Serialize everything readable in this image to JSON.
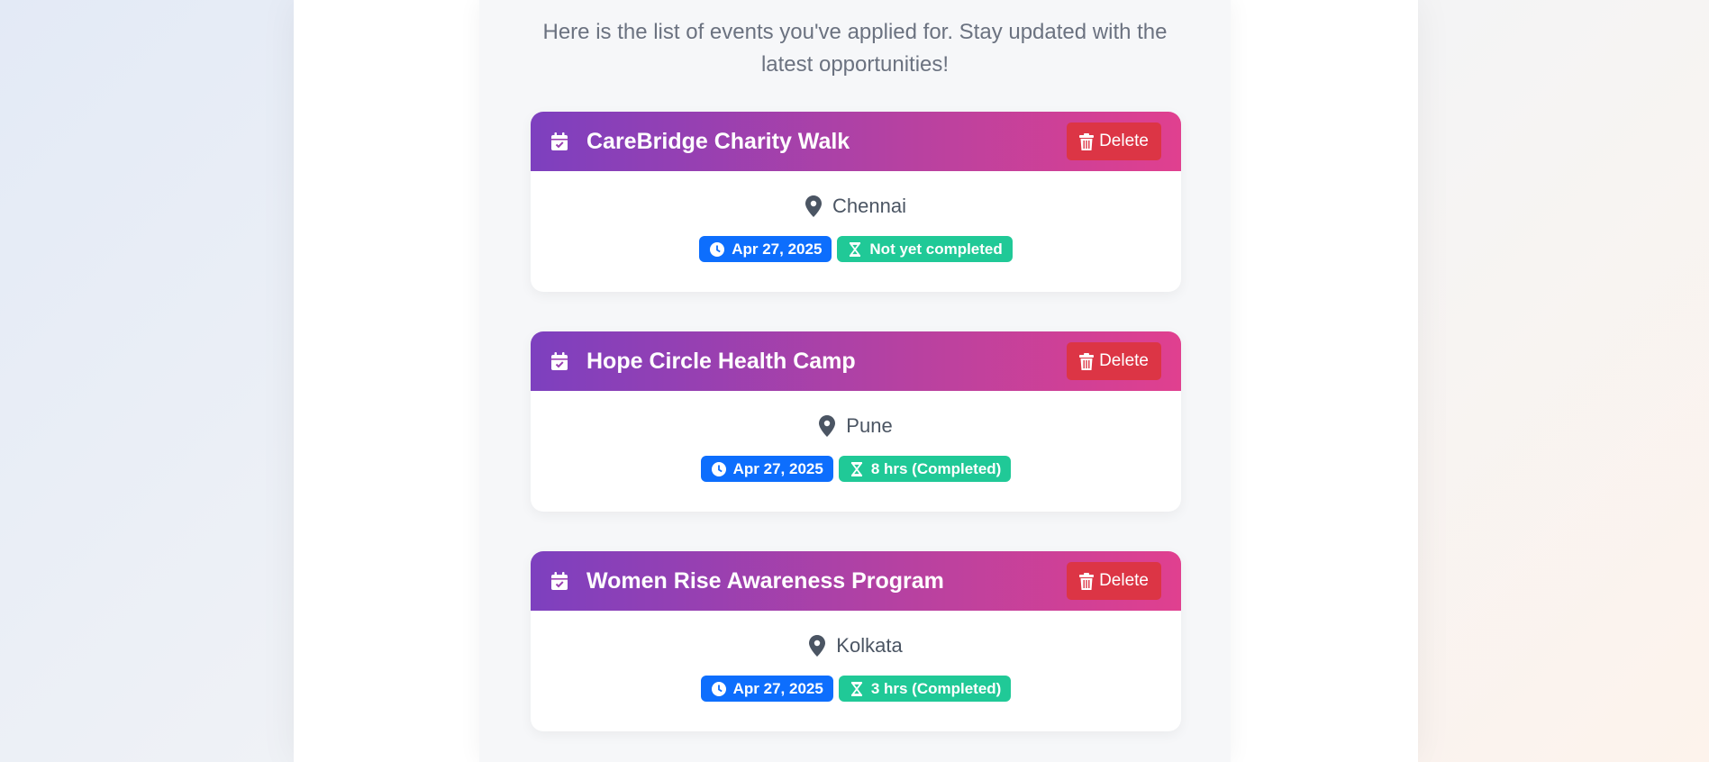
{
  "intro_text": "Here is the list of events you've applied for. Stay updated with the latest opportunities!",
  "delete_label": "Delete",
  "events": [
    {
      "title": "CareBridge Charity Walk",
      "location": "Chennai",
      "date": "Apr 27, 2025",
      "status": "Not yet completed"
    },
    {
      "title": "Hope Circle Health Camp",
      "location": "Pune",
      "date": "Apr 27, 2025",
      "status": "8 hrs (Completed)"
    },
    {
      "title": "Women Rise Awareness Program",
      "location": "Kolkata",
      "date": "Apr 27, 2025",
      "status": "3 hrs (Completed)"
    }
  ],
  "icons": {
    "header": "calendar-check-icon",
    "delete": "trash-icon",
    "location": "map-pin-icon",
    "date": "clock-icon",
    "status": "hourglass-icon"
  },
  "colors": {
    "header_gradient_start": "#7d40bf",
    "header_gradient_end": "#e0408f",
    "delete_button": "#dc3545",
    "date_badge": "#0d6efd",
    "status_badge": "#20c997"
  }
}
